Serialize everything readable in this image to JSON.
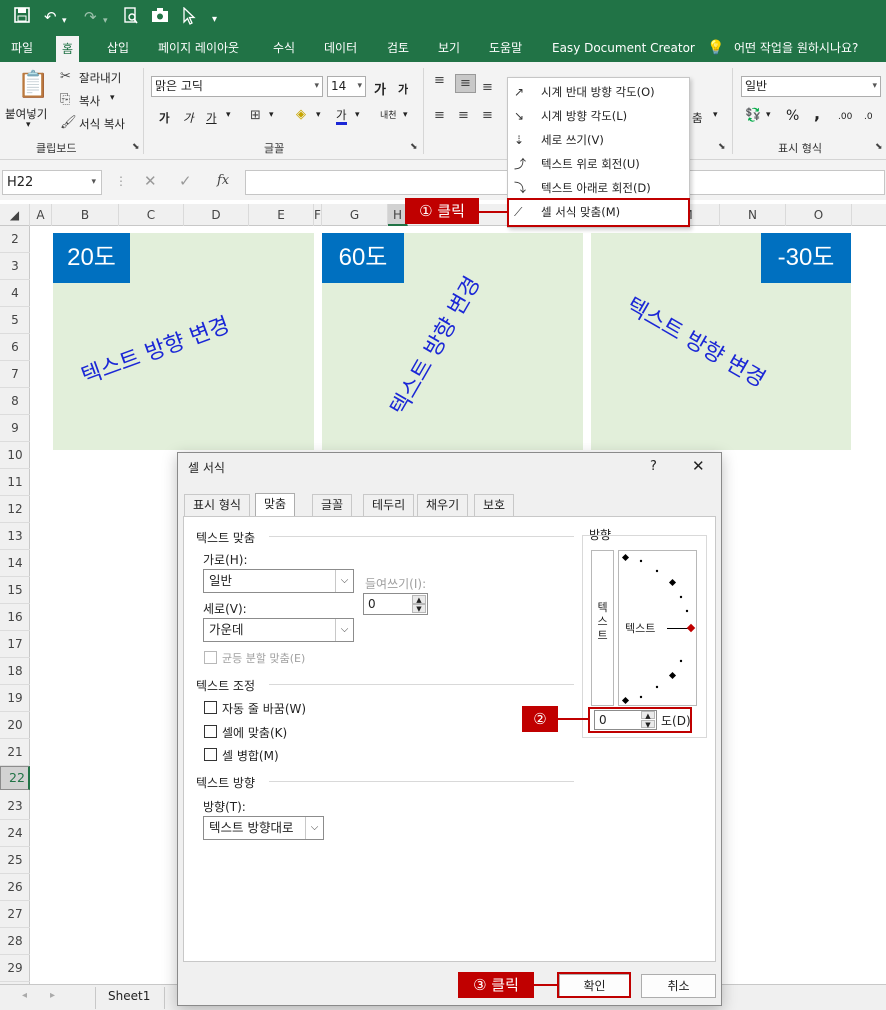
{
  "quick_access": {
    "icons": [
      "save-icon",
      "undo-icon",
      "redo-icon",
      "print-preview-icon",
      "camera-icon",
      "cursor-icon",
      "customize-icon"
    ]
  },
  "tabs": [
    "파일",
    "홈",
    "삽입",
    "페이지 레이아웃",
    "수식",
    "데이터",
    "검토",
    "보기",
    "도움말",
    "Easy Document Creator"
  ],
  "tell_me": "어떤 작업을 원하시나요?",
  "ribbon": {
    "clipboard": {
      "paste": "붙여넣기",
      "cut": "잘라내기",
      "copy": "복사",
      "format_painter": "서식 복사",
      "label": "클립보드"
    },
    "font": {
      "name": "맑은 고딕",
      "size": "14",
      "grow": "가",
      "shrink": "가",
      "bold": "가",
      "italic": "가",
      "underline": "가",
      "font_color_glyph": "가",
      "phonetic": "내천",
      "label": "글꼴"
    },
    "alignment": {
      "partial": "춤"
    },
    "number": {
      "format": "일반",
      "percent": "%",
      "comma": ",",
      "inc_dec": ".00",
      "dec_dec": ".0",
      "label": "표시 형식"
    }
  },
  "formula_bar": {
    "name_box": "H22",
    "fx": "fx",
    "cancel": "✕",
    "enter": "✓"
  },
  "columns": [
    "A",
    "B",
    "C",
    "D",
    "E",
    "F",
    "G",
    "H",
    "M",
    "N",
    "O"
  ],
  "rows": [
    "2",
    "3",
    "4",
    "5",
    "6",
    "7",
    "8",
    "9",
    "10",
    "11",
    "12",
    "13",
    "14",
    "15",
    "16",
    "17",
    "18",
    "19",
    "20",
    "21",
    "22",
    "23",
    "24",
    "25",
    "26",
    "27",
    "28",
    "29"
  ],
  "selected_row": "22",
  "examples": [
    {
      "badge": "20도",
      "text": "텍스트 방향 변경",
      "angle": 20
    },
    {
      "badge": "60도",
      "text": "텍스트 방향 변경",
      "angle": 60
    },
    {
      "badge": "-30도",
      "text": "텍스트 방향 변경",
      "angle": -30
    }
  ],
  "sheet_tab": "Sheet1",
  "orientation_menu": {
    "items": [
      {
        "label": "시계 반대 방향 각도(O)",
        "icon": "ab-diagonal-up-icon"
      },
      {
        "label": "시계 방향 각도(L)",
        "icon": "ab-diagonal-down-icon"
      },
      {
        "label": "세로 쓰기(V)",
        "icon": "vertical-text-icon"
      },
      {
        "label": "텍스트 위로 회전(U)",
        "icon": "rotate-up-icon"
      },
      {
        "label": "텍스트 아래로 회전(D)",
        "icon": "rotate-down-icon"
      },
      {
        "label": "셀 서식 맞춤(M)",
        "icon": "format-alignment-icon"
      }
    ]
  },
  "dialog": {
    "title": "셀 서식",
    "help": "?",
    "close": "✕",
    "tabs": [
      "표시 형식",
      "맞춤",
      "글꼴",
      "테두리",
      "채우기",
      "보호"
    ],
    "active_tab": "맞춤",
    "text_alignment": {
      "heading": "텍스트 맞춤",
      "horizontal_label": "가로(H):",
      "horizontal_value": "일반",
      "indent_label": "들여쓰기(I):",
      "indent_value": "0",
      "vertical_label": "세로(V):",
      "vertical_value": "가운데",
      "justify_distributed": "균등 분할 맞춤(E)"
    },
    "text_control": {
      "heading": "텍스트 조정",
      "wrap": "자동 줄 바꿈(W)",
      "shrink": "셀에 맞춤(K)",
      "merge": "셀 병합(M)"
    },
    "rtl": {
      "heading": "텍스트 방향",
      "direction_label": "방향(T):",
      "direction_value": "텍스트 방향대로"
    },
    "orientation": {
      "heading": "방향",
      "vertical_text": "텍스트",
      "dial_text": "텍스트",
      "degrees_value": "0",
      "degrees_label": "도(D)",
      "angle": 0
    },
    "ok": "확인",
    "cancel": "취소"
  },
  "callouts": {
    "step1": "① 클릭",
    "step2": "②",
    "step3": "③ 클릭"
  },
  "colors": {
    "excel_green": "#217346",
    "panel_fill": "#e2efda",
    "badge_blue": "#0070c0",
    "rotated_text": "#1b27d6",
    "callout_red": "#c00000"
  }
}
